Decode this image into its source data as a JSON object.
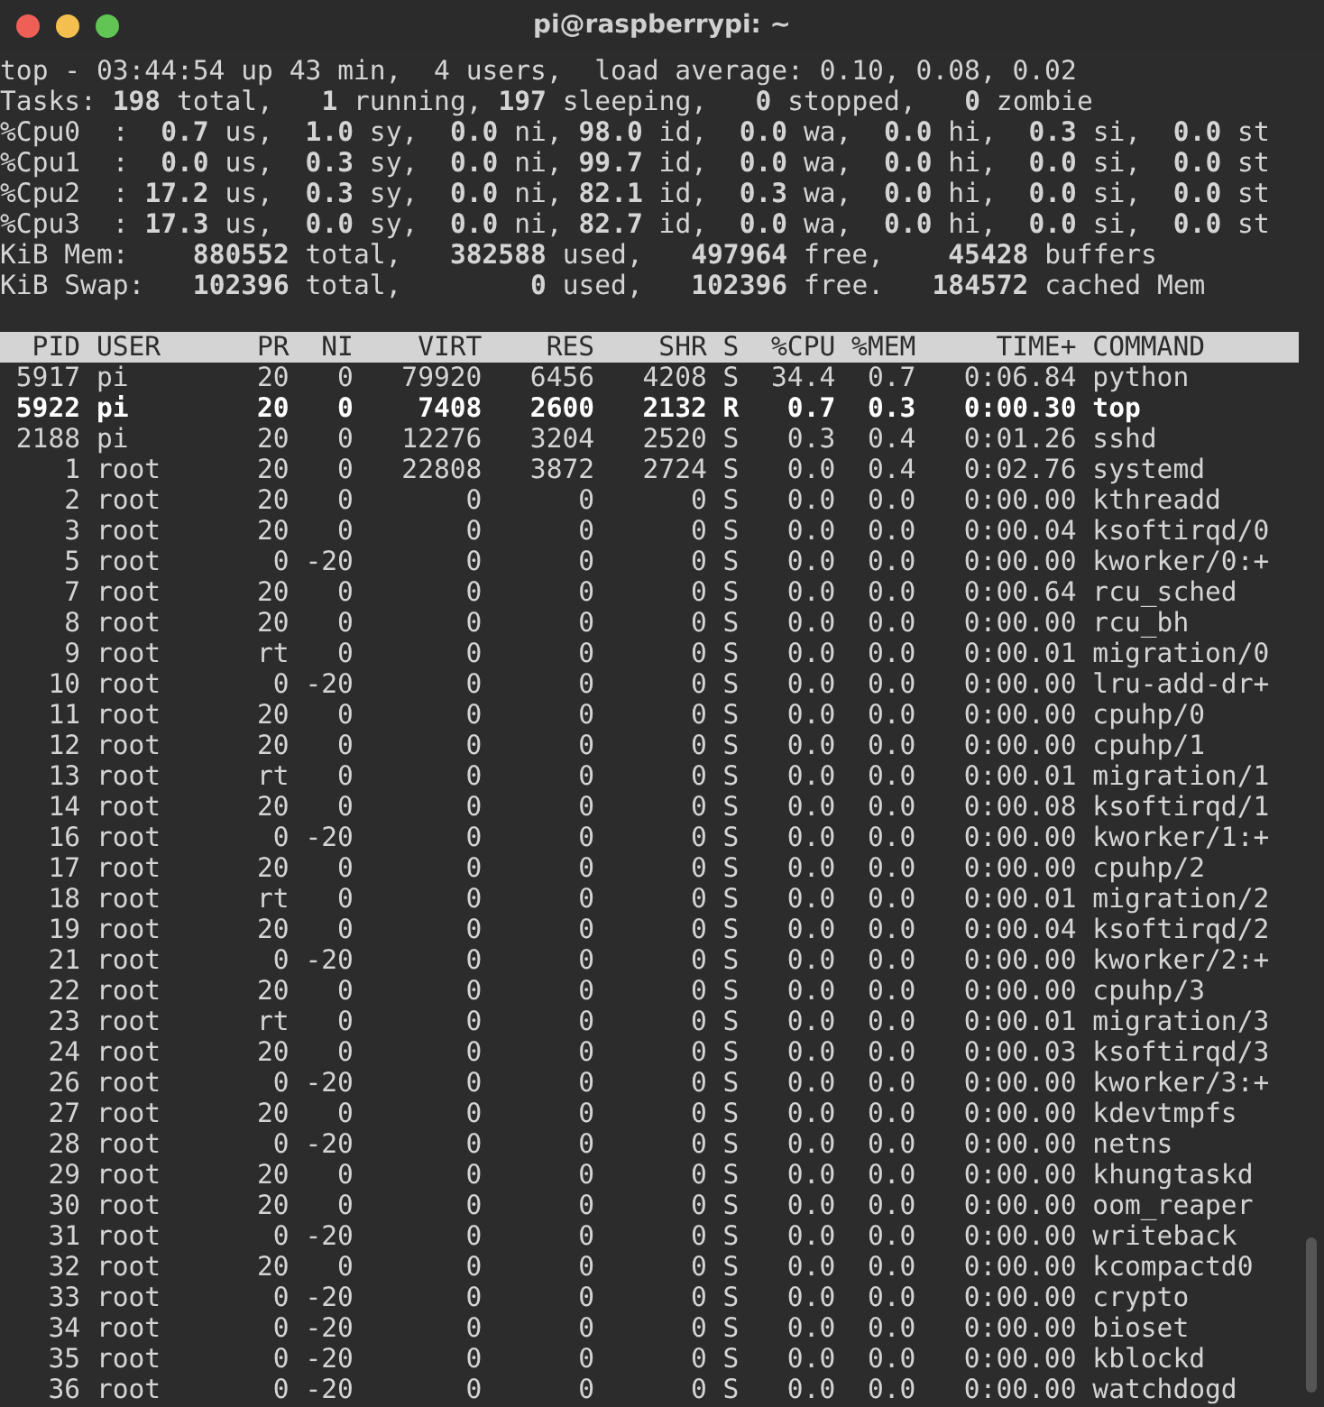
{
  "window": {
    "title": "pi@raspberrypi: ~"
  },
  "summary": [
    "top - 03:44:54 up 43 min,  4 users,  load average: 0.10, 0.08, 0.02",
    "Tasks: **198** total,   **1** running, **197** sleeping,   **0** stopped,   **0** zombie",
    "%Cpu0  :  **0.7** us,  **1.0** sy,  **0.0** ni, **98.0** id,  **0.0** wa,  **0.0** hi,  **0.3** si,  **0.0** st",
    "%Cpu1  :  **0.0** us,  **0.3** sy,  **0.0** ni, **99.7** id,  **0.0** wa,  **0.0** hi,  **0.0** si,  **0.0** st",
    "%Cpu2  : **17.2** us,  **0.3** sy,  **0.0** ni, **82.1** id,  **0.3** wa,  **0.0** hi,  **0.0** si,  **0.0** st",
    "%Cpu3  : **17.3** us,  **0.0** sy,  **0.0** ni, **82.7** id,  **0.0** wa,  **0.0** hi,  **0.0** si,  **0.0** st",
    "KiB Mem:    **880552** total,   **382588** used,   **497964** free,    **45428** buffers",
    "KiB Swap:   **102396** total,        **0** used,   **102396** free.   **184572** cached Mem"
  ],
  "table": {
    "columns": [
      "PID",
      "USER",
      "PR",
      "NI",
      "VIRT",
      "RES",
      "SHR",
      "S",
      "%CPU",
      "%MEM",
      "TIME+",
      "COMMAND"
    ],
    "rows": [
      {
        "cells": [
          "5917",
          "pi",
          "20",
          "0",
          "79920",
          "6456",
          "4208",
          "S",
          "34.4",
          "0.7",
          "0:06.84",
          "python"
        ],
        "bold": false
      },
      {
        "cells": [
          "5922",
          "pi",
          "20",
          "0",
          "7408",
          "2600",
          "2132",
          "R",
          "0.7",
          "0.3",
          "0:00.30",
          "top"
        ],
        "bold": true
      },
      {
        "cells": [
          "2188",
          "pi",
          "20",
          "0",
          "12276",
          "3204",
          "2520",
          "S",
          "0.3",
          "0.4",
          "0:01.26",
          "sshd"
        ],
        "bold": false
      },
      {
        "cells": [
          "1",
          "root",
          "20",
          "0",
          "22808",
          "3872",
          "2724",
          "S",
          "0.0",
          "0.4",
          "0:02.76",
          "systemd"
        ],
        "bold": false
      },
      {
        "cells": [
          "2",
          "root",
          "20",
          "0",
          "0",
          "0",
          "0",
          "S",
          "0.0",
          "0.0",
          "0:00.00",
          "kthreadd"
        ],
        "bold": false
      },
      {
        "cells": [
          "3",
          "root",
          "20",
          "0",
          "0",
          "0",
          "0",
          "S",
          "0.0",
          "0.0",
          "0:00.04",
          "ksoftirqd/0"
        ],
        "bold": false
      },
      {
        "cells": [
          "5",
          "root",
          "0",
          "-20",
          "0",
          "0",
          "0",
          "S",
          "0.0",
          "0.0",
          "0:00.00",
          "kworker/0:+"
        ],
        "bold": false
      },
      {
        "cells": [
          "7",
          "root",
          "20",
          "0",
          "0",
          "0",
          "0",
          "S",
          "0.0",
          "0.0",
          "0:00.64",
          "rcu_sched"
        ],
        "bold": false
      },
      {
        "cells": [
          "8",
          "root",
          "20",
          "0",
          "0",
          "0",
          "0",
          "S",
          "0.0",
          "0.0",
          "0:00.00",
          "rcu_bh"
        ],
        "bold": false
      },
      {
        "cells": [
          "9",
          "root",
          "rt",
          "0",
          "0",
          "0",
          "0",
          "S",
          "0.0",
          "0.0",
          "0:00.01",
          "migration/0"
        ],
        "bold": false
      },
      {
        "cells": [
          "10",
          "root",
          "0",
          "-20",
          "0",
          "0",
          "0",
          "S",
          "0.0",
          "0.0",
          "0:00.00",
          "lru-add-dr+"
        ],
        "bold": false
      },
      {
        "cells": [
          "11",
          "root",
          "20",
          "0",
          "0",
          "0",
          "0",
          "S",
          "0.0",
          "0.0",
          "0:00.00",
          "cpuhp/0"
        ],
        "bold": false
      },
      {
        "cells": [
          "12",
          "root",
          "20",
          "0",
          "0",
          "0",
          "0",
          "S",
          "0.0",
          "0.0",
          "0:00.00",
          "cpuhp/1"
        ],
        "bold": false
      },
      {
        "cells": [
          "13",
          "root",
          "rt",
          "0",
          "0",
          "0",
          "0",
          "S",
          "0.0",
          "0.0",
          "0:00.01",
          "migration/1"
        ],
        "bold": false
      },
      {
        "cells": [
          "14",
          "root",
          "20",
          "0",
          "0",
          "0",
          "0",
          "S",
          "0.0",
          "0.0",
          "0:00.08",
          "ksoftirqd/1"
        ],
        "bold": false
      },
      {
        "cells": [
          "16",
          "root",
          "0",
          "-20",
          "0",
          "0",
          "0",
          "S",
          "0.0",
          "0.0",
          "0:00.00",
          "kworker/1:+"
        ],
        "bold": false
      },
      {
        "cells": [
          "17",
          "root",
          "20",
          "0",
          "0",
          "0",
          "0",
          "S",
          "0.0",
          "0.0",
          "0:00.00",
          "cpuhp/2"
        ],
        "bold": false
      },
      {
        "cells": [
          "18",
          "root",
          "rt",
          "0",
          "0",
          "0",
          "0",
          "S",
          "0.0",
          "0.0",
          "0:00.01",
          "migration/2"
        ],
        "bold": false
      },
      {
        "cells": [
          "19",
          "root",
          "20",
          "0",
          "0",
          "0",
          "0",
          "S",
          "0.0",
          "0.0",
          "0:00.04",
          "ksoftirqd/2"
        ],
        "bold": false
      },
      {
        "cells": [
          "21",
          "root",
          "0",
          "-20",
          "0",
          "0",
          "0",
          "S",
          "0.0",
          "0.0",
          "0:00.00",
          "kworker/2:+"
        ],
        "bold": false
      },
      {
        "cells": [
          "22",
          "root",
          "20",
          "0",
          "0",
          "0",
          "0",
          "S",
          "0.0",
          "0.0",
          "0:00.00",
          "cpuhp/3"
        ],
        "bold": false
      },
      {
        "cells": [
          "23",
          "root",
          "rt",
          "0",
          "0",
          "0",
          "0",
          "S",
          "0.0",
          "0.0",
          "0:00.01",
          "migration/3"
        ],
        "bold": false
      },
      {
        "cells": [
          "24",
          "root",
          "20",
          "0",
          "0",
          "0",
          "0",
          "S",
          "0.0",
          "0.0",
          "0:00.03",
          "ksoftirqd/3"
        ],
        "bold": false
      },
      {
        "cells": [
          "26",
          "root",
          "0",
          "-20",
          "0",
          "0",
          "0",
          "S",
          "0.0",
          "0.0",
          "0:00.00",
          "kworker/3:+"
        ],
        "bold": false
      },
      {
        "cells": [
          "27",
          "root",
          "20",
          "0",
          "0",
          "0",
          "0",
          "S",
          "0.0",
          "0.0",
          "0:00.00",
          "kdevtmpfs"
        ],
        "bold": false
      },
      {
        "cells": [
          "28",
          "root",
          "0",
          "-20",
          "0",
          "0",
          "0",
          "S",
          "0.0",
          "0.0",
          "0:00.00",
          "netns"
        ],
        "bold": false
      },
      {
        "cells": [
          "29",
          "root",
          "20",
          "0",
          "0",
          "0",
          "0",
          "S",
          "0.0",
          "0.0",
          "0:00.00",
          "khungtaskd"
        ],
        "bold": false
      },
      {
        "cells": [
          "30",
          "root",
          "20",
          "0",
          "0",
          "0",
          "0",
          "S",
          "0.0",
          "0.0",
          "0:00.00",
          "oom_reaper"
        ],
        "bold": false
      },
      {
        "cells": [
          "31",
          "root",
          "0",
          "-20",
          "0",
          "0",
          "0",
          "S",
          "0.0",
          "0.0",
          "0:00.00",
          "writeback"
        ],
        "bold": false
      },
      {
        "cells": [
          "32",
          "root",
          "20",
          "0",
          "0",
          "0",
          "0",
          "S",
          "0.0",
          "0.0",
          "0:00.00",
          "kcompactd0"
        ],
        "bold": false
      },
      {
        "cells": [
          "33",
          "root",
          "0",
          "-20",
          "0",
          "0",
          "0",
          "S",
          "0.0",
          "0.0",
          "0:00.00",
          "crypto"
        ],
        "bold": false
      },
      {
        "cells": [
          "34",
          "root",
          "0",
          "-20",
          "0",
          "0",
          "0",
          "S",
          "0.0",
          "0.0",
          "0:00.00",
          "bioset"
        ],
        "bold": false
      },
      {
        "cells": [
          "35",
          "root",
          "0",
          "-20",
          "0",
          "0",
          "0",
          "S",
          "0.0",
          "0.0",
          "0:00.00",
          "kblockd"
        ],
        "bold": false
      },
      {
        "cells": [
          "36",
          "root",
          "0",
          "-20",
          "0",
          "0",
          "0",
          "S",
          "0.0",
          "0.0",
          "0:00.00",
          "watchdogd"
        ],
        "bold": false
      }
    ]
  }
}
